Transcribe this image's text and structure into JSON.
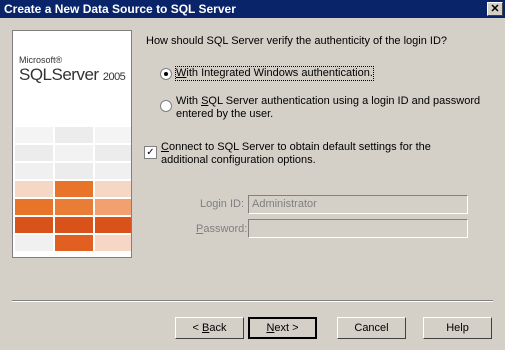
{
  "window": {
    "title": "Create a New Data Source to SQL Server",
    "close_glyph": "✕"
  },
  "logo": {
    "brand": "Microsoft®",
    "product": "SQLServer",
    "year": "2005"
  },
  "auth": {
    "question": "How should SQL Server verify the authenticity of the login ID?",
    "options": [
      {
        "pre": "",
        "mnemonic": "W",
        "post": "ith Integrated Windows authentication.",
        "checked": true
      },
      {
        "pre": "With ",
        "mnemonic": "S",
        "post": "QL Server authentication using a login ID and password",
        "line2": "entered by the user.",
        "checked": false
      }
    ]
  },
  "connect": {
    "mnemonic": "C",
    "text": "onnect to SQL Server to obtain default settings for the",
    "line2": "additional configuration options.",
    "checked": true
  },
  "fields": {
    "login_label": "Login ID:",
    "login_value": "Administrator",
    "password_label": "assword:",
    "password_mnemonic": "P",
    "password_value": ""
  },
  "buttons": {
    "back_mnemonic": "B",
    "back_text": "ack",
    "next_mnemonic": "N",
    "next_text": "ext >",
    "cancel": "Cancel",
    "help": "Help"
  },
  "colors": {
    "titlebar": "#0a246a",
    "orange": "#e8742a",
    "dark_orange": "#d8521a",
    "light_tile": "#f0f0f0"
  }
}
